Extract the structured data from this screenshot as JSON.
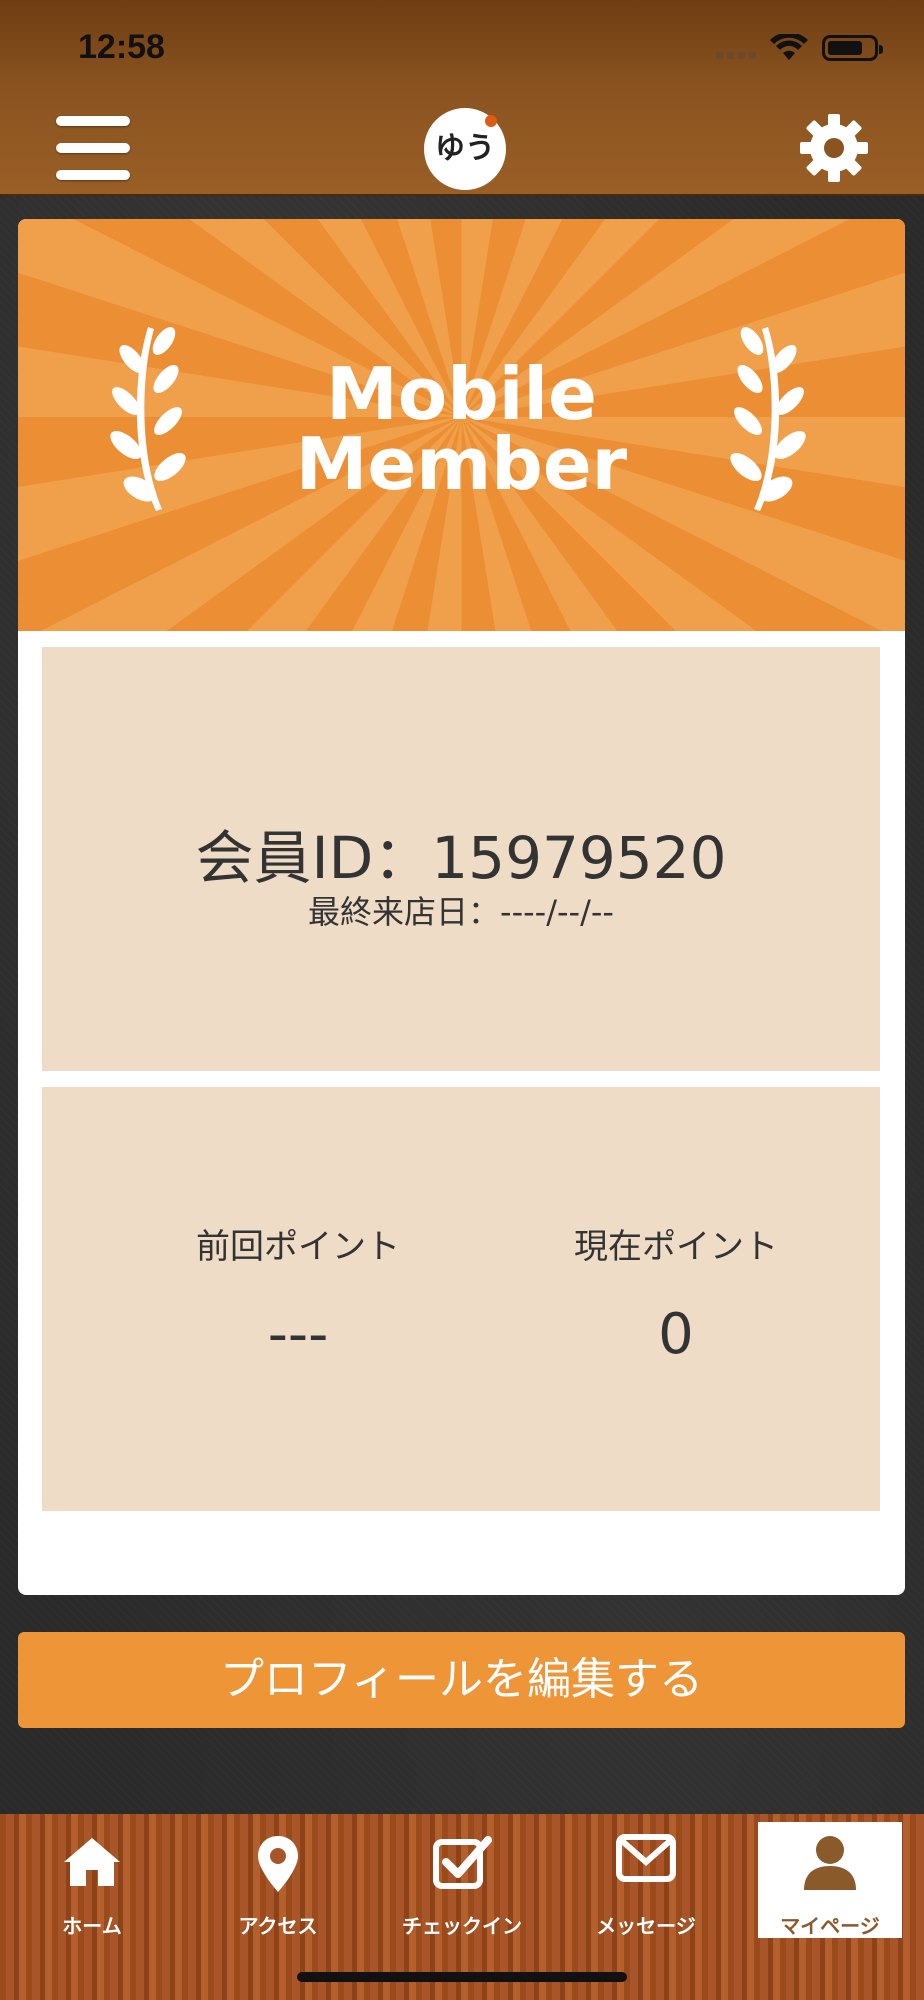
{
  "status_bar": {
    "time": "12:58"
  },
  "header": {
    "logo_glyph": "ゆう"
  },
  "banner": {
    "title_line1": "Mobile",
    "title_line2": "Member"
  },
  "member": {
    "id_text": "会員ID：15979520",
    "last_visit_text": "最終来店日：----/--/--"
  },
  "points": {
    "previous_label": "前回ポイント",
    "previous_value": "---",
    "current_label": "現在ポイント",
    "current_value": "0"
  },
  "edit_profile_button": "プロフィールを編集する",
  "tabs": [
    {
      "label": "ホーム",
      "icon": "home-icon"
    },
    {
      "label": "アクセス",
      "icon": "map-pin-icon"
    },
    {
      "label": "チェックイン",
      "icon": "checkbox-icon"
    },
    {
      "label": "メッセージ",
      "icon": "envelope-icon"
    },
    {
      "label": "マイページ",
      "icon": "user-icon",
      "active": true
    }
  ],
  "colors": {
    "accent": "#ed9537",
    "panel": "#efdcc6",
    "header": "#8a5320"
  }
}
